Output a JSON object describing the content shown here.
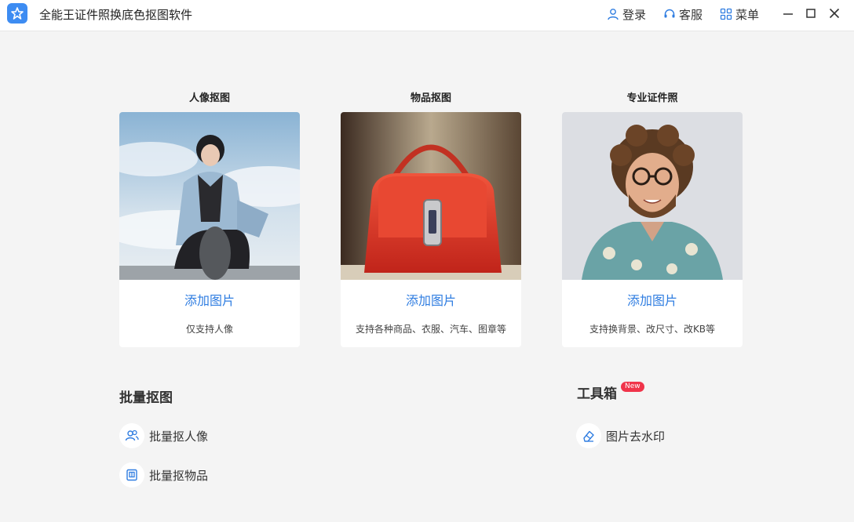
{
  "app": {
    "title": "全能王证件照换底色抠图软件",
    "accent": "#2f7de1"
  },
  "header": {
    "login": "登录",
    "service": "客服",
    "menu": "菜单"
  },
  "cards": [
    {
      "heading": "人像抠图",
      "add": "添加图片",
      "desc": "仅支持人像"
    },
    {
      "heading": "物品抠图",
      "add": "添加图片",
      "desc": "支持各种商品、衣服、汽车、图章等"
    },
    {
      "heading": "专业证件照",
      "add": "添加图片",
      "desc": "支持换背景、改尺寸、改KB等"
    }
  ],
  "batch": {
    "title": "批量抠图",
    "items": [
      "批量抠人像",
      "批量抠物品"
    ]
  },
  "toolbox": {
    "title": "工具箱",
    "badge": "New",
    "items": [
      "图片去水印"
    ]
  }
}
